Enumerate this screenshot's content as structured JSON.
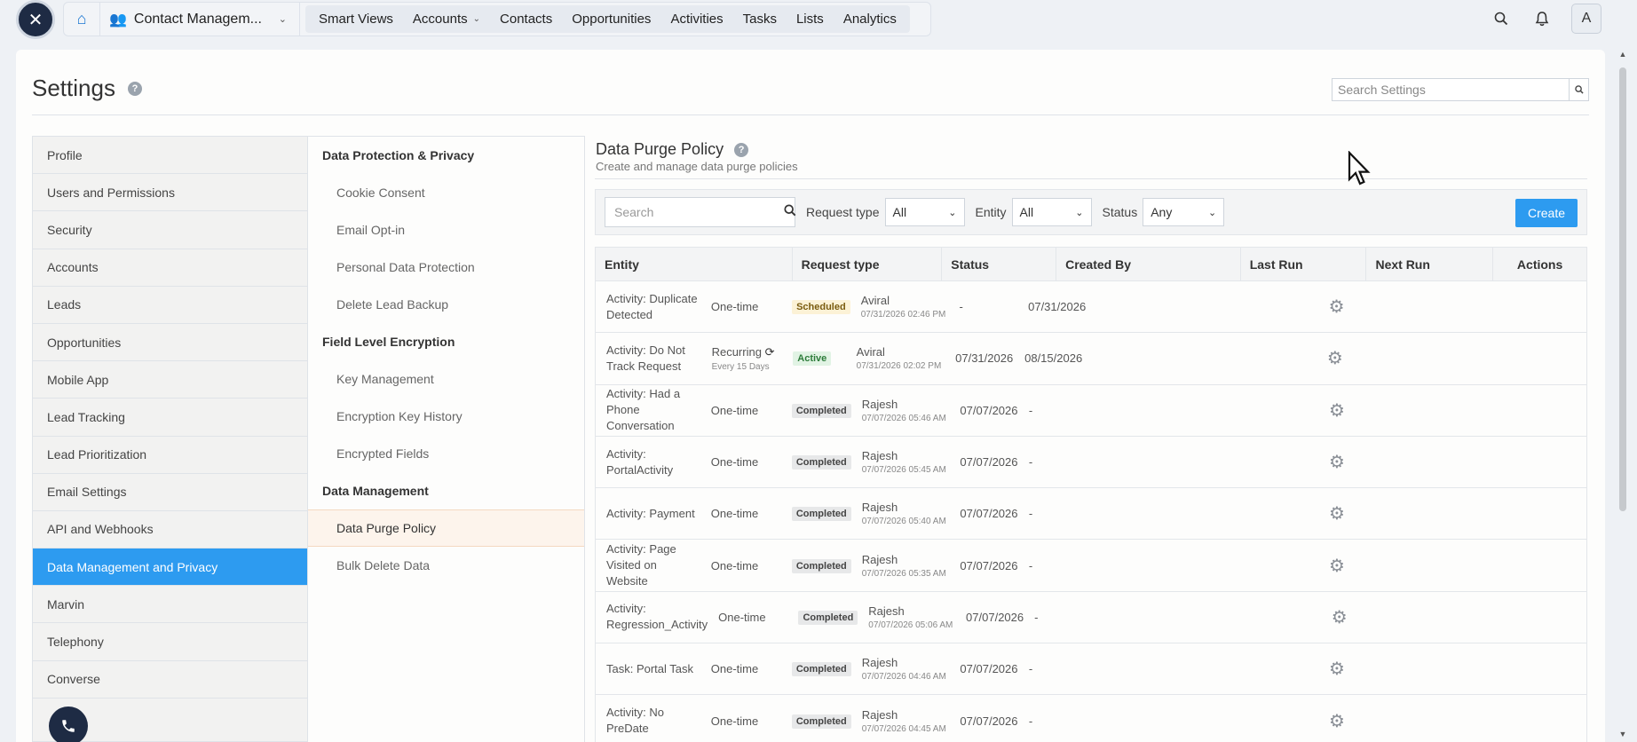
{
  "topbar": {
    "app_name": "Contact Managem...",
    "nav": [
      "Smart Views",
      "Accounts",
      "Contacts",
      "Opportunities",
      "Activities",
      "Tasks",
      "Lists",
      "Analytics"
    ],
    "avatar_initial": "A"
  },
  "settings": {
    "title": "Settings",
    "search_placeholder": "Search Settings"
  },
  "leftmenu": {
    "items": [
      "Profile",
      "Users and Permissions",
      "Security",
      "Accounts",
      "Leads",
      "Opportunities",
      "Mobile App",
      "Lead Tracking",
      "Lead Prioritization",
      "Email Settings",
      "API and Webhooks",
      "Data Management and Privacy",
      "Marvin",
      "Telephony",
      "Converse"
    ],
    "active": "Data Management and Privacy"
  },
  "submenu": {
    "groups": [
      {
        "heading": "Data Protection & Privacy",
        "items": [
          "Cookie Consent",
          "Email Opt-in",
          "Personal Data Protection",
          "Delete Lead Backup"
        ]
      },
      {
        "heading": "Field Level Encryption",
        "items": [
          "Key Management",
          "Encryption Key History",
          "Encrypted Fields"
        ]
      },
      {
        "heading": "Data Management",
        "items": [
          "Data Purge Policy",
          "Bulk Delete Data"
        ]
      }
    ],
    "active": "Data Purge Policy"
  },
  "content": {
    "title": "Data Purge Policy",
    "subtitle": "Create and manage data purge policies",
    "filters": {
      "search_placeholder": "Search",
      "request_type_label": "Request type",
      "request_type_value": "All",
      "entity_label": "Entity",
      "entity_value": "All",
      "status_label": "Status",
      "status_value": "Any"
    },
    "create_label": "Create",
    "columns": [
      "Entity",
      "Request type",
      "Status",
      "Created By",
      "Last Run",
      "Next Run",
      "Actions"
    ],
    "rows": [
      {
        "entity": "Activity: Duplicate Detected",
        "request": "One-time",
        "request_sub": "",
        "status": "Scheduled",
        "by": "Aviral",
        "by_date": "07/31/2026 02:46 PM",
        "last": "-",
        "next": "07/31/2026"
      },
      {
        "entity": "Activity: Do Not Track Request",
        "request": "Recurring",
        "request_sub": "Every 15 Days",
        "status": "Active",
        "by": "Aviral",
        "by_date": "07/31/2026 02:02 PM",
        "last": "07/31/2026",
        "next": "08/15/2026"
      },
      {
        "entity": "Activity: Had a Phone Conversation",
        "request": "One-time",
        "request_sub": "",
        "status": "Completed",
        "by": "Rajesh",
        "by_date": "07/07/2026 05:46 AM",
        "last": "07/07/2026",
        "next": "-"
      },
      {
        "entity": "Activity: PortalActivity",
        "request": "One-time",
        "request_sub": "",
        "status": "Completed",
        "by": "Rajesh",
        "by_date": "07/07/2026 05:45 AM",
        "last": "07/07/2026",
        "next": "-"
      },
      {
        "entity": "Activity: Payment",
        "request": "One-time",
        "request_sub": "",
        "status": "Completed",
        "by": "Rajesh",
        "by_date": "07/07/2026 05:40 AM",
        "last": "07/07/2026",
        "next": "-"
      },
      {
        "entity": "Activity: Page Visited on Website",
        "request": "One-time",
        "request_sub": "",
        "status": "Completed",
        "by": "Rajesh",
        "by_date": "07/07/2026 05:35 AM",
        "last": "07/07/2026",
        "next": "-"
      },
      {
        "entity": "Activity: Regression_Activity",
        "request": "One-time",
        "request_sub": "",
        "status": "Completed",
        "by": "Rajesh",
        "by_date": "07/07/2026 05:06 AM",
        "last": "07/07/2026",
        "next": "-"
      },
      {
        "entity": "Task: Portal Task",
        "request": "One-time",
        "request_sub": "",
        "status": "Completed",
        "by": "Rajesh",
        "by_date": "07/07/2026 04:46 AM",
        "last": "07/07/2026",
        "next": "-"
      },
      {
        "entity": "Activity: No PreDate",
        "request": "One-time",
        "request_sub": "",
        "status": "Completed",
        "by": "Rajesh",
        "by_date": "07/07/2026 04:45 AM",
        "last": "07/07/2026",
        "next": "-"
      }
    ]
  },
  "icons": {
    "home": "home-icon",
    "app": "users-icon",
    "search": "search-icon",
    "notifications": "bell-icon",
    "help": "help-icon",
    "gear": "gear-icon",
    "recurring": "refresh-icon",
    "phone": "phone-icon"
  },
  "colors": {
    "accent": "#2d9bf0",
    "brand_dark": "#1e2b44"
  }
}
